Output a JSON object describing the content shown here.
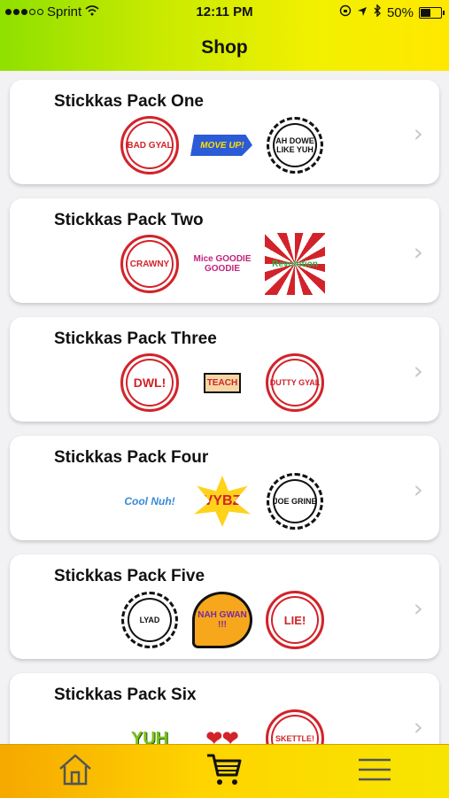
{
  "status": {
    "carrier": "Sprint",
    "time": "12:11 PM",
    "battery": "50%"
  },
  "header": {
    "title": "Shop"
  },
  "packs": [
    {
      "title": "Stickkas Pack One",
      "stickers": [
        "BAD GYAL",
        "MOVE UP!",
        "AH DOWE LIKE YUH"
      ]
    },
    {
      "title": "Stickkas Pack Two",
      "stickers": [
        "CRAWNY",
        "Mice GOODIE GOODIE",
        "Revolution"
      ]
    },
    {
      "title": "Stickkas Pack Three",
      "stickers": [
        "DWL!",
        "TEACH",
        "DUTTY GYAL"
      ]
    },
    {
      "title": "Stickkas Pack Four",
      "stickers": [
        "Cool Nuh!",
        "VYBZ",
        "JOE GRINE"
      ]
    },
    {
      "title": "Stickkas Pack Five",
      "stickers": [
        "LYAD",
        "NAH GWAN !!!",
        "LIE!"
      ]
    },
    {
      "title": "Stickkas Pack Six",
      "stickers": [
        "YUH",
        "hearts",
        "SKETTLE!"
      ]
    }
  ],
  "tabbar": {
    "icons": [
      "home-icon",
      "cart-icon",
      "menu-icon"
    ]
  }
}
